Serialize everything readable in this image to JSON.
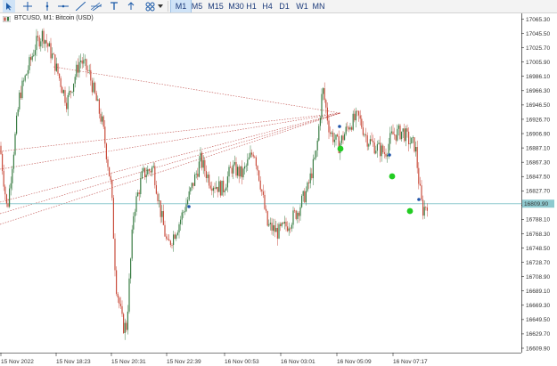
{
  "toolbar": {
    "tools": [
      "cursor-icon",
      "crosshair-icon",
      "vertical-line-icon",
      "horizontal-line-icon",
      "trend-line-icon",
      "channel-icon",
      "text-tool-icon",
      "arrow-up-icon",
      "shapes-icon",
      "dropdown-icon"
    ],
    "timeframes": [
      "M1",
      "M5",
      "M15",
      "M30",
      "H1",
      "H4",
      "D1",
      "W1",
      "MN"
    ],
    "active_timeframe": "M1"
  },
  "chart": {
    "title": "BTCUSD, M1:  Bitcoin (USD)",
    "current_price": "16809.90",
    "price_ticks": [
      "17065.30",
      "17045.50",
      "17025.70",
      "17005.90",
      "16986.10",
      "16966.30",
      "16946.50",
      "16926.70",
      "16906.90",
      "16887.10",
      "16867.30",
      "16847.50",
      "16827.70",
      "16807.90",
      "16788.10",
      "16768.30",
      "16748.50",
      "16728.70",
      "16708.90",
      "16689.10",
      "16669.30",
      "16649.50",
      "16629.70",
      "16609.90"
    ],
    "time_ticks": [
      "15 Nov 2022",
      "15 Nov 18:23",
      "15 Nov 20:31",
      "15 Nov 22:39",
      "16 Nov 00:53",
      "16 Nov 03:01",
      "16 Nov 05:09",
      "16 Nov 07:17"
    ],
    "colors": {
      "up": "#3a7d44",
      "down": "#c94c3c",
      "bid_line": "#8ec9cf",
      "trend_line": "#c0504d",
      "signal": "#22cc22",
      "marker": "#2255aa"
    }
  }
}
